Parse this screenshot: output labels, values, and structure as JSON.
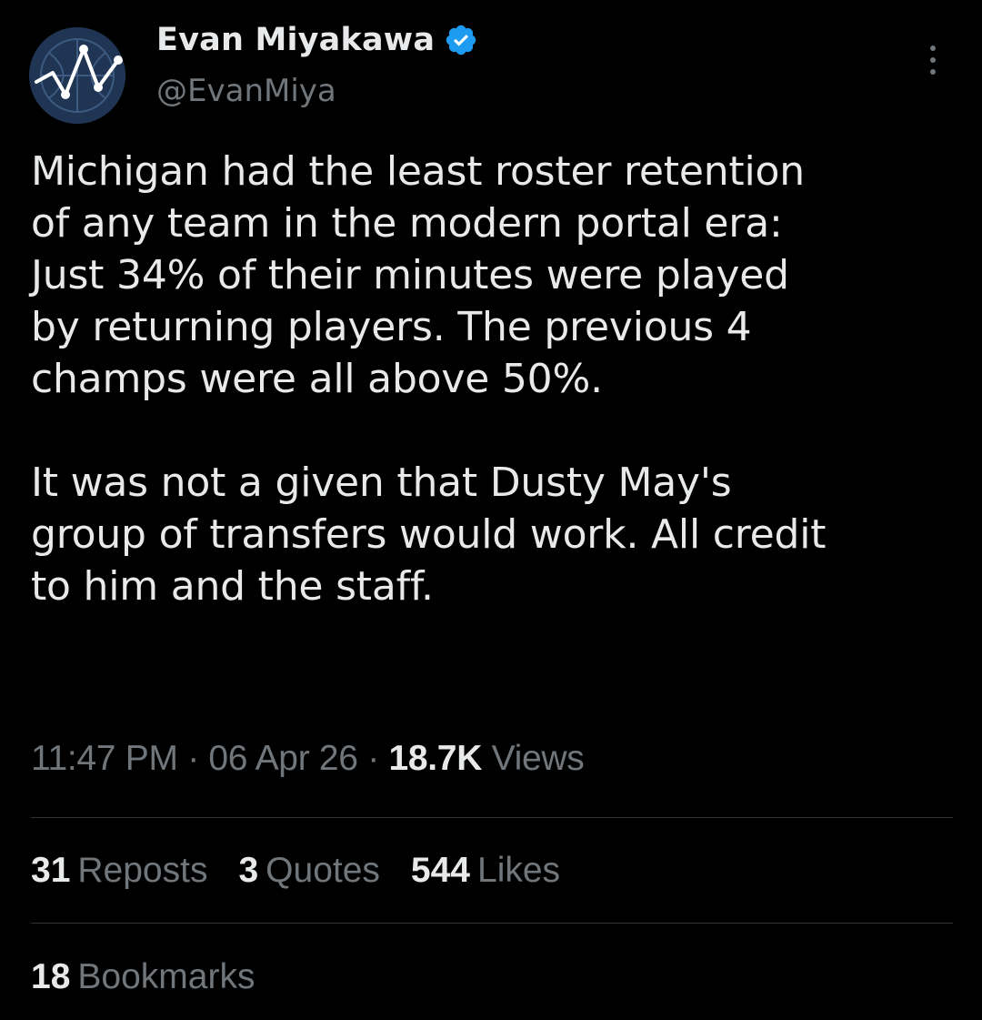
{
  "author": {
    "display_name": "Evan Miyakawa",
    "handle": "@EvanMiya",
    "verified": true,
    "avatar_icon": "basketball-chart-icon"
  },
  "tweet": {
    "paragraphs": [
      "Michigan had the least roster retention\nof any team in the modern portal era:\nJust 34% of their minutes were played\nby returning players. The previous 4\nchamps were all above 50%.",
      "It was not a given that Dusty May's\ngroup of transfers would work. All credit\nto him and the staff."
    ]
  },
  "meta": {
    "time": "11:47 PM",
    "separator": "·",
    "date": "06 Apr 26",
    "views_count": "18.7K",
    "views_label": "Views"
  },
  "stats": {
    "reposts_count": "31",
    "reposts_label": "Reposts",
    "quotes_count": "3",
    "quotes_label": "Quotes",
    "likes_count": "544",
    "likes_label": "Likes",
    "bookmarks_count": "18",
    "bookmarks_label": "Bookmarks"
  },
  "colors": {
    "background": "#000000",
    "primary_text": "#e7e9ea",
    "secondary_text": "#71767b",
    "verified_blue": "#1d9bf0",
    "divider": "#2f3336"
  }
}
